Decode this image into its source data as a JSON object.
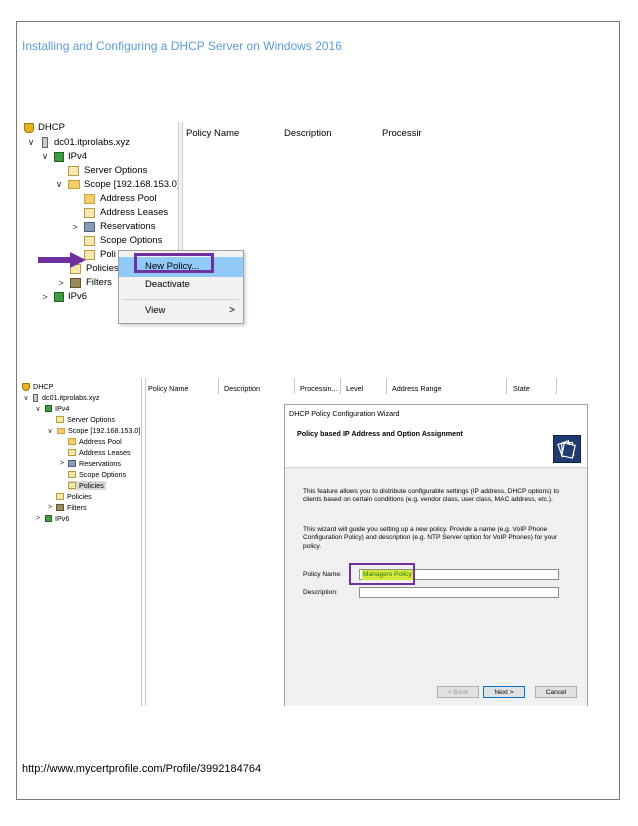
{
  "document": {
    "title": "Installing and Configuring a DHCP Server on Windows 2016",
    "footer_url": "http://www.mycertprofile.com/Profile/3992184764"
  },
  "shot1": {
    "tree": {
      "root": "DHCP",
      "server": "dc01.itprolabs.xyz",
      "ipv4": "IPv4",
      "server_options": "Server Options",
      "scope": "Scope [192.168.153.0]",
      "address_pool": "Address Pool",
      "address_leases": "Address Leases",
      "reservations": "Reservations",
      "scope_options": "Scope Options",
      "policies_truncated": "Poli",
      "policies": "Policies",
      "filters": "Filters",
      "ipv6": "IPv6"
    },
    "columns": [
      "Policy Name",
      "Description",
      "Processir"
    ],
    "context_menu": {
      "new_policy": "New Policy...",
      "deactivate": "Deactivate",
      "view": "View",
      "view_chevron": ">"
    }
  },
  "shot2": {
    "tree": {
      "root": "DHCP",
      "server": "dc01.itprolabs.xyz",
      "ipv4": "IPv4",
      "server_options": "Server Options",
      "scope": "Scope [192.168.153.0]",
      "address_pool": "Address Pool",
      "address_leases": "Address Leases",
      "reservations": "Reservations",
      "scope_options": "Scope Options",
      "policies_selected": "Policies",
      "policies": "Policies",
      "filters": "Filters",
      "ipv6": "IPv6"
    },
    "columns": [
      "Policy Name",
      "Description",
      "Processin...",
      "Level",
      "Address Range",
      "State"
    ],
    "wizard": {
      "title": "DHCP Policy Configuration Wizard",
      "heading": "Policy based IP Address and Option Assignment",
      "para1": "This feature allows you to distribute configurable settings (IP address, DHCP options) to clients based on certain conditions (e.g. vendor class, user class, MAC address, etc.).",
      "para2": "This wizard will guide you setting up a new policy. Provide a name (e.g. VoIP Phone Configuration Policy) and description (e.g. NTP Server option for VoIP Phones) for your policy.",
      "policy_name_label": "Policy Name:",
      "policy_name_value": "Managers Policy",
      "description_label": "Description:",
      "description_value": "",
      "back_button": "< Back",
      "next_button": "Next >",
      "cancel_button": "Cancel"
    }
  },
  "colors": {
    "title_blue": "#5b9bd5",
    "highlight_purple": "#7030a0",
    "menu_highlight": "#91c9f7"
  }
}
